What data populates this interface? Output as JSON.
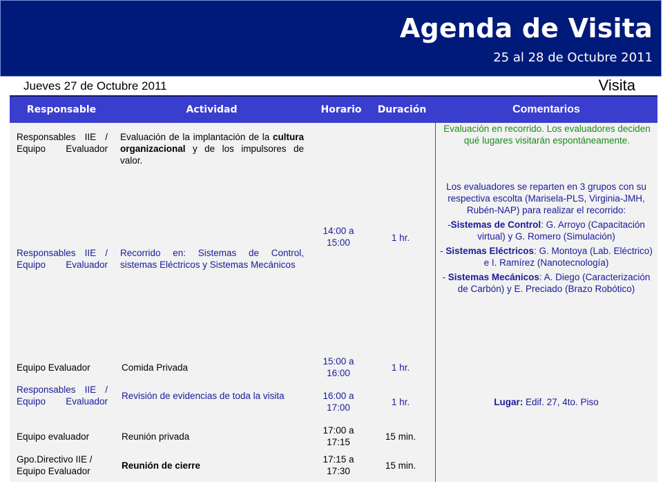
{
  "title": "Agenda de Visita",
  "subtitle": "25 al 28 de Octubre 2011",
  "day_label": "Jueves 27 de Octubre 2011",
  "visit_label": "Visita",
  "headers": {
    "responsable": "Responsable",
    "actividad": "Actividad",
    "horario": "Horario",
    "duracion": "Duración",
    "comentarios": "Comentarios"
  },
  "rows": [
    {
      "responsable": "Responsables IIE / Equipo Evaluador",
      "actividad_pre": "Evaluación de la implantación de la ",
      "actividad_bold": "cultura organizacional",
      "actividad_post": " y de los impulsores de valor."
    },
    {
      "responsable": "Responsables IIE / Equipo Evaluador",
      "actividad": "Recorrido en: Sistemas de Control, sistemas Eléctricos y Sistemas Mecánicos",
      "horario": "14:00 a 15:00",
      "duracion": "1 hr."
    },
    {
      "responsable": "Equipo Evaluador",
      "actividad": "Comida Privada",
      "horario": "15:00 a 16:00",
      "duracion": "1 hr."
    },
    {
      "responsable": "Responsables IIE / Equipo Evaluador",
      "actividad": "Revisión de evidencias de toda la visita",
      "horario": "16:00 a 17:00",
      "duracion": "1 hr."
    },
    {
      "responsable": "Equipo evaluador",
      "actividad": "Reunión privada",
      "horario": "17:00 a 17:15",
      "duracion": "15 min."
    },
    {
      "responsable": "Gpo.Directivo IIE / Equipo Evaluador",
      "actividad": "Reunión de cierre",
      "horario": "17:15 a 17:30",
      "duracion": "15 min."
    }
  ],
  "comments": {
    "c1": "Evaluación en recorrido. Los evaluadores deciden qué lugares visitarán espontáneamente.",
    "c2": "Los evaluadores se reparten en 3 grupos con su respectiva escolta (Marisela-PLS, Virginia-JMH, Rubén-NAP) para realizar el recorrido:",
    "c3_pre": "-",
    "c3_bold": "Sistemas de Control",
    "c3_post": ": G. Arroyo (Capacitación virtual) y G. Romero (Simulación)",
    "c4_pre": "- ",
    "c4_bold": "Sistemas Eléctricos",
    "c4_post": ": G. Montoya (Lab. Eléctrico) e I. Ramírez (Nanotecnología)",
    "c5_pre": "- ",
    "c5_bold": "Sistemas Mecánicos",
    "c5_post": ": A. Diego (Caracterización de Carbón) y E. Preciado (Brazo Robótico)",
    "lugar_label": "Lugar:",
    "lugar_value": " Edif. 27, 4to. Piso"
  },
  "colors": {
    "banner": "#001a7a",
    "header": "#3a3ecf",
    "blue_text": "#1a1a9a",
    "green_text": "#1a8a1a"
  }
}
